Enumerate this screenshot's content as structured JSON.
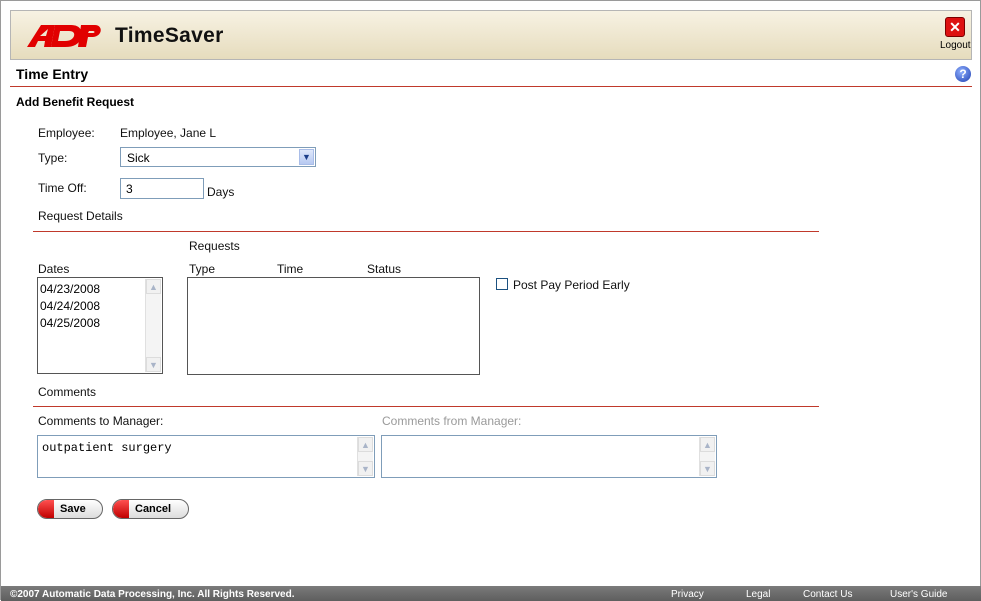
{
  "app": {
    "brand": "ADP",
    "title": "TimeSaver",
    "logout_label": "Logout",
    "colors": {
      "accent_red": "#c0392b",
      "header_bg": "#efe7cf",
      "footer_bg": "#6b6b6b"
    }
  },
  "page": {
    "title": "Time Entry",
    "help_icon": "?",
    "section_title": "Add Benefit Request"
  },
  "form": {
    "employee_label": "Employee:",
    "employee_value": "Employee, Jane L",
    "type_label": "Type:",
    "type_value": "Sick",
    "time_off_label": "Time Off:",
    "time_off_value": "3",
    "time_off_unit": "Days"
  },
  "request_details": {
    "header": "Request Details",
    "requests_label": "Requests",
    "dates_label": "Dates",
    "dates": [
      "04/23/2008",
      "04/24/2008",
      "04/25/2008"
    ],
    "columns": [
      "Type",
      "Time",
      "Status"
    ],
    "post_early_label": "Post Pay Period Early",
    "post_early_checked": false
  },
  "comments": {
    "header": "Comments",
    "to_manager_label": "Comments to Manager:",
    "to_manager_value": "outpatient surgery",
    "from_manager_label": "Comments from Manager:",
    "from_manager_value": ""
  },
  "actions": {
    "save_label": "Save",
    "cancel_label": "Cancel"
  },
  "footer": {
    "copyright": "©2007 Automatic Data Processing, Inc. All Rights Reserved.",
    "links": [
      "Privacy",
      "Legal",
      "Contact Us",
      "User's Guide"
    ]
  }
}
